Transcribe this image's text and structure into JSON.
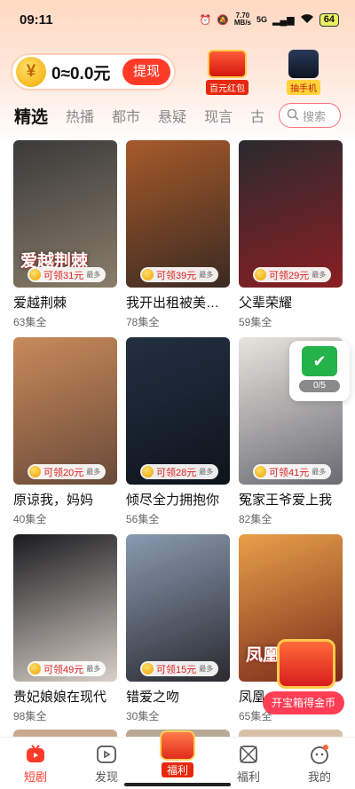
{
  "status_bar": {
    "time": "09:11",
    "net_speed_value": "7.70",
    "net_speed_unit": "MB/s",
    "network": "5G",
    "battery": "64"
  },
  "wallet": {
    "coin_symbol": "¥",
    "amount": "0≈0.0元",
    "withdraw_label": "提现"
  },
  "promos": [
    {
      "label": "百元红包",
      "icon": "red-envelope-icon"
    },
    {
      "label": "抽手机",
      "icon": "phone-icon"
    }
  ],
  "tabs": [
    "精选",
    "热播",
    "都市",
    "悬疑",
    "现言",
    "古"
  ],
  "search": {
    "placeholder": "搜索"
  },
  "dramas": [
    {
      "name": "爱越荆棘",
      "episodes": "63集全",
      "reward": "可领31元",
      "reward_tag": "最多",
      "cover_text": "爱越荆棘",
      "colors": [
        "#3a3a3a",
        "#8a7d6a"
      ]
    },
    {
      "name": "我开出租被美…",
      "episodes": "78集全",
      "reward": "可领39元",
      "reward_tag": "最多",
      "cover_text": "",
      "colors": [
        "#a65a2a",
        "#3a2a22"
      ]
    },
    {
      "name": "父辈荣耀",
      "episodes": "59集全",
      "reward": "可领29元",
      "reward_tag": "最多",
      "cover_text": "",
      "colors": [
        "#2a2a2e",
        "#8a1f24"
      ]
    },
    {
      "name": "原谅我，妈妈",
      "episodes": "40集全",
      "reward": "可领20元",
      "reward_tag": "最多",
      "cover_text": "",
      "colors": [
        "#c88a5a",
        "#6a4a3a"
      ]
    },
    {
      "name": "倾尽全力拥抱你",
      "episodes": "56集全",
      "reward": "可领28元",
      "reward_tag": "最多",
      "cover_text": "",
      "colors": [
        "#223042",
        "#0e141c"
      ]
    },
    {
      "name": "冤家王爷爱上我",
      "episodes": "82集全",
      "reward": "可领41元",
      "reward_tag": "最多",
      "cover_text": "",
      "colors": [
        "#e8e4de",
        "#6a6a72"
      ]
    },
    {
      "name": "贵妃娘娘在现代",
      "episodes": "98集全",
      "reward": "可领49元",
      "reward_tag": "最多",
      "cover_text": "",
      "colors": [
        "#1a1a1e",
        "#d8d0c8"
      ]
    },
    {
      "name": "错爱之吻",
      "episodes": "30集全",
      "reward": "可领15元",
      "reward_tag": "最多",
      "cover_text": "",
      "colors": [
        "#8a9ab0",
        "#2a2a30"
      ]
    },
    {
      "name": "凤凰…",
      "episodes": "65集全",
      "reward": "",
      "reward_tag": "",
      "cover_text": "凤凰鸣天",
      "colors": [
        "#e8a04a",
        "#7a2a1a"
      ]
    }
  ],
  "float_task": {
    "progress": "0/5"
  },
  "treasure": {
    "label": "开宝箱得金币"
  },
  "bottom_nav": [
    {
      "label": "短剧",
      "icon": "short-drama-icon",
      "active": true
    },
    {
      "label": "发现",
      "icon": "discover-icon",
      "active": false
    },
    {
      "label": "福利",
      "icon": "welfare-envelope-icon",
      "active": false
    },
    {
      "label": "福利",
      "icon": "gift-icon",
      "active": false
    },
    {
      "label": "我的",
      "icon": "profile-icon",
      "active": false
    }
  ]
}
